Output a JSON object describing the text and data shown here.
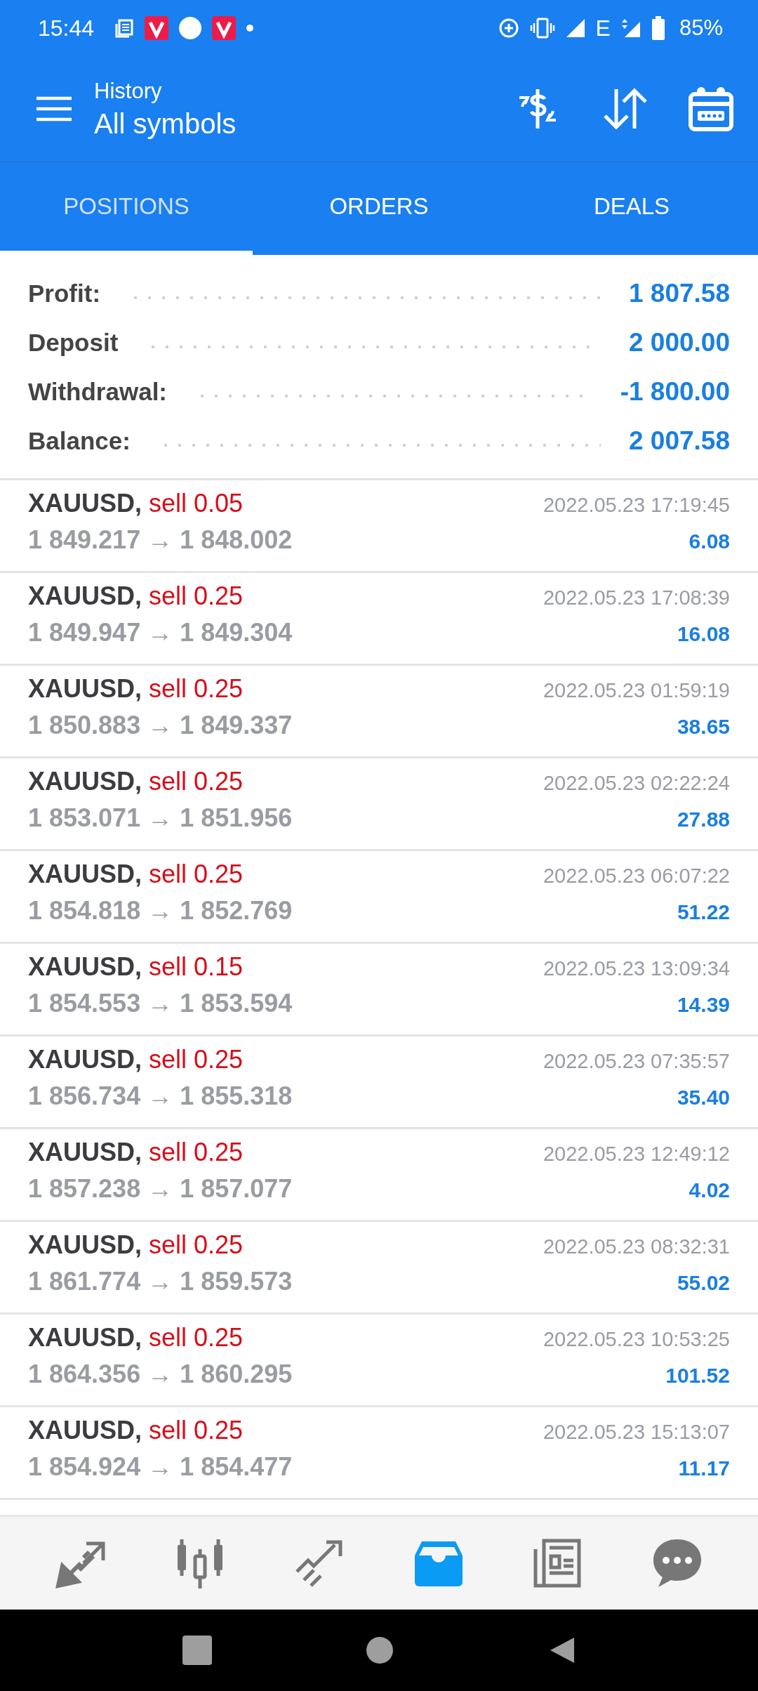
{
  "status_bar": {
    "time": "15:44",
    "network": "E",
    "battery": "85%"
  },
  "header": {
    "subtitle": "History",
    "title": "All symbols"
  },
  "tabs": [
    {
      "label": "POSITIONS",
      "selected": true
    },
    {
      "label": "ORDERS",
      "selected": false
    },
    {
      "label": "DEALS",
      "selected": false
    }
  ],
  "summary": [
    {
      "label": "Profit:",
      "value": "1 807.58"
    },
    {
      "label": "Deposit",
      "value": "2 000.00"
    },
    {
      "label": "Withdrawal:",
      "value": "-1 800.00"
    },
    {
      "label": "Balance:",
      "value": "2 007.58"
    }
  ],
  "positions": [
    {
      "symbol": "XAUUSD,",
      "side": "sell 0.05",
      "prices": "1 849.217 → 1 848.002",
      "time": "2022.05.23 17:19:45",
      "profit": "6.08"
    },
    {
      "symbol": "XAUUSD,",
      "side": "sell 0.25",
      "prices": "1 849.947 → 1 849.304",
      "time": "2022.05.23 17:08:39",
      "profit": "16.08"
    },
    {
      "symbol": "XAUUSD,",
      "side": "sell 0.25",
      "prices": "1 850.883 → 1 849.337",
      "time": "2022.05.23 01:59:19",
      "profit": "38.65"
    },
    {
      "symbol": "XAUUSD,",
      "side": "sell 0.25",
      "prices": "1 853.071 → 1 851.956",
      "time": "2022.05.23 02:22:24",
      "profit": "27.88"
    },
    {
      "symbol": "XAUUSD,",
      "side": "sell 0.25",
      "prices": "1 854.818 → 1 852.769",
      "time": "2022.05.23 06:07:22",
      "profit": "51.22"
    },
    {
      "symbol": "XAUUSD,",
      "side": "sell 0.15",
      "prices": "1 854.553 → 1 853.594",
      "time": "2022.05.23 13:09:34",
      "profit": "14.39"
    },
    {
      "symbol": "XAUUSD,",
      "side": "sell 0.25",
      "prices": "1 856.734 → 1 855.318",
      "time": "2022.05.23 07:35:57",
      "profit": "35.40"
    },
    {
      "symbol": "XAUUSD,",
      "side": "sell 0.25",
      "prices": "1 857.238 → 1 857.077",
      "time": "2022.05.23 12:49:12",
      "profit": "4.02"
    },
    {
      "symbol": "XAUUSD,",
      "side": "sell 0.25",
      "prices": "1 861.774 → 1 859.573",
      "time": "2022.05.23 08:32:31",
      "profit": "55.02"
    },
    {
      "symbol": "XAUUSD,",
      "side": "sell 0.25",
      "prices": "1 864.356 → 1 860.295",
      "time": "2022.05.23 10:53:25",
      "profit": "101.52"
    },
    {
      "symbol": "XAUUSD,",
      "side": "sell 0.25",
      "prices": "1 854.924 → 1 854.477",
      "time": "2022.05.23 15:13:07",
      "profit": "11.17"
    }
  ],
  "bottom_nav": [
    {
      "kind": "quotes",
      "selected": false
    },
    {
      "kind": "chart",
      "selected": false
    },
    {
      "kind": "trade",
      "selected": false
    },
    {
      "kind": "history",
      "selected": true
    },
    {
      "kind": "news",
      "selected": false
    },
    {
      "kind": "chat",
      "selected": false
    }
  ]
}
